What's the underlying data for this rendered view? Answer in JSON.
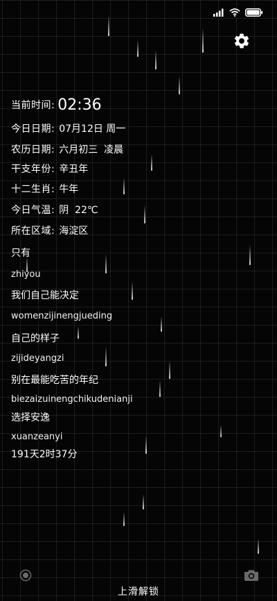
{
  "status_bar": {
    "icons": [
      "signal-icon",
      "wifi-icon",
      "battery-icon"
    ]
  },
  "settings": {
    "icon": "gear-icon"
  },
  "info": {
    "time_label": "当前时间:",
    "time_value": "02:36",
    "date_label": "今日日期:",
    "date_value": "07月12日 周一",
    "lunar_label": "农历日期:",
    "lunar_value": "六月初三  凌晨",
    "ganzhi_label": "干支年份:",
    "ganzhi_value": "辛丑年",
    "zodiac_label": "十二生肖:",
    "zodiac_value": "牛年",
    "weather_label": "今日气温:",
    "weather_value": "阴  22℃",
    "region_label": "所在区域:",
    "region_value": "海淀区"
  },
  "poem": [
    {
      "cn": "只有",
      "py": "zhiyou"
    },
    {
      "cn": "我们自己能决定",
      "py": "womenzijinengjueding"
    },
    {
      "cn": "自己的样子",
      "py": "zijideyangzi"
    },
    {
      "cn": "别在最能吃苦的年纪",
      "py": "biezaizuinengchikudenianji"
    },
    {
      "cn": "选择安逸",
      "py": "xuanzeanyi"
    }
  ],
  "countdown": "191天2时37分",
  "bottom": {
    "unlock_text": "上滑解锁",
    "left_icon": "record-icon",
    "right_icon": "camera-icon"
  },
  "colors": {
    "background": "#050505",
    "text": "#ffffff",
    "grid": "rgba(255,255,255,0.09)"
  }
}
